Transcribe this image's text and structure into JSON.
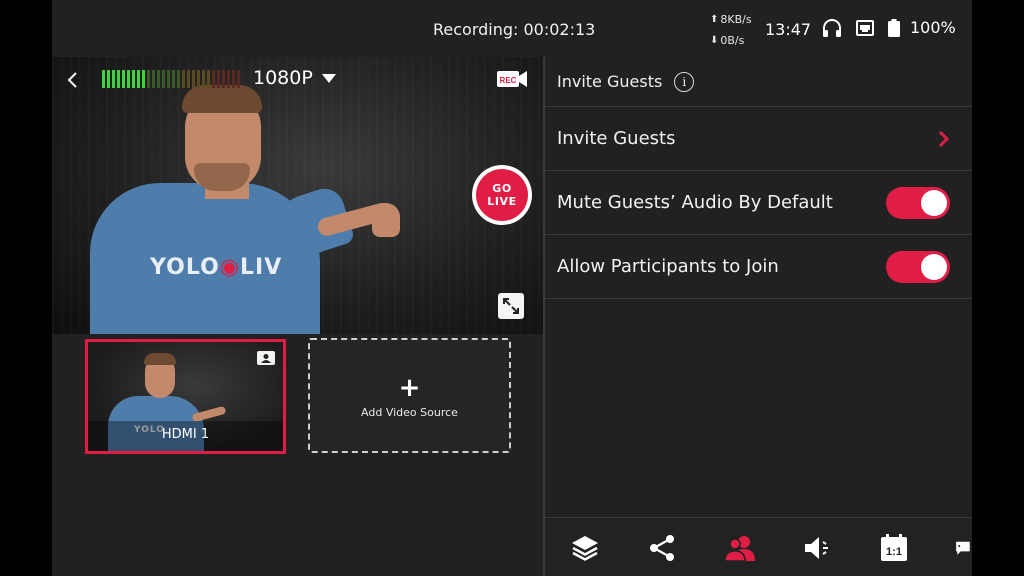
{
  "status_bar": {
    "recording": "Recording: 00:02:13",
    "upload_rate": "8KB/s",
    "download_rate": "0B/s",
    "time": "13:47",
    "battery": "100%"
  },
  "preview": {
    "resolution": "1080P",
    "go_live_line1": "GO",
    "go_live_line2": "LIVE",
    "shirt_logo_pre": "YOLO",
    "shirt_logo_post": "LIV"
  },
  "sources": {
    "hdmi_label": "HDMI 1",
    "add_label": "Add Video Source"
  },
  "guests_panel": {
    "header": "Invite Guests",
    "rows": [
      {
        "label": "Invite Guests"
      },
      {
        "label": "Mute Guests’ Audio By Default",
        "toggle_on": true
      },
      {
        "label": "Allow Participants to Join",
        "toggle_on": true
      }
    ]
  },
  "toolbar": {
    "aspect_label": "1:1",
    "active": "guests"
  },
  "colors": {
    "accent": "#e01e45",
    "background": "#212121",
    "divider": "#3a3a3a"
  }
}
